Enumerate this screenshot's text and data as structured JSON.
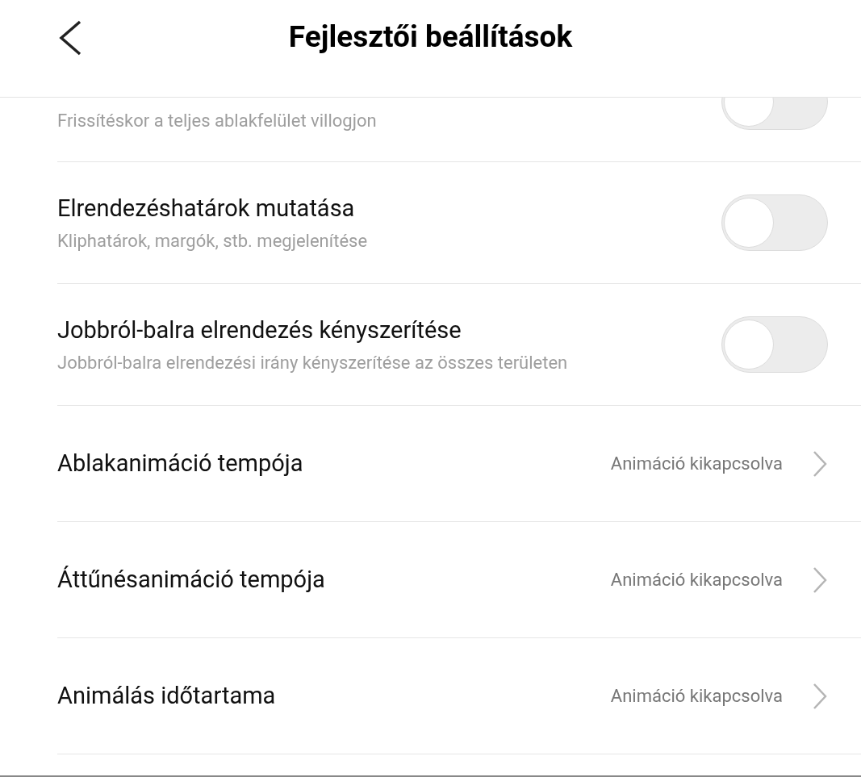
{
  "header": {
    "title": "Fejlesztői beállítások"
  },
  "items": [
    {
      "kind": "toggle",
      "subtitle": "Frissítéskor a teljes ablakfelület villogjon",
      "on": false,
      "cut": true
    },
    {
      "kind": "toggle",
      "title": "Elrendezéshatárok mutatása",
      "subtitle": "Kliphatárok, margók, stb. megjelenítése",
      "on": false
    },
    {
      "kind": "toggle",
      "title": "Jobbról-balra elrendezés kényszerítése",
      "subtitle": "Jobbról-balra elrendezési irány kényszerítése az összes területen",
      "on": false
    },
    {
      "kind": "nav",
      "title": "Ablakanimáció tempója",
      "value": "Animáció kikapcsolva"
    },
    {
      "kind": "nav",
      "title": "Áttűnésanimáció tempója",
      "value": "Animáció kikapcsolva"
    },
    {
      "kind": "nav",
      "title": "Animálás időtartama",
      "value": "Animáció kikapcsolva"
    }
  ]
}
